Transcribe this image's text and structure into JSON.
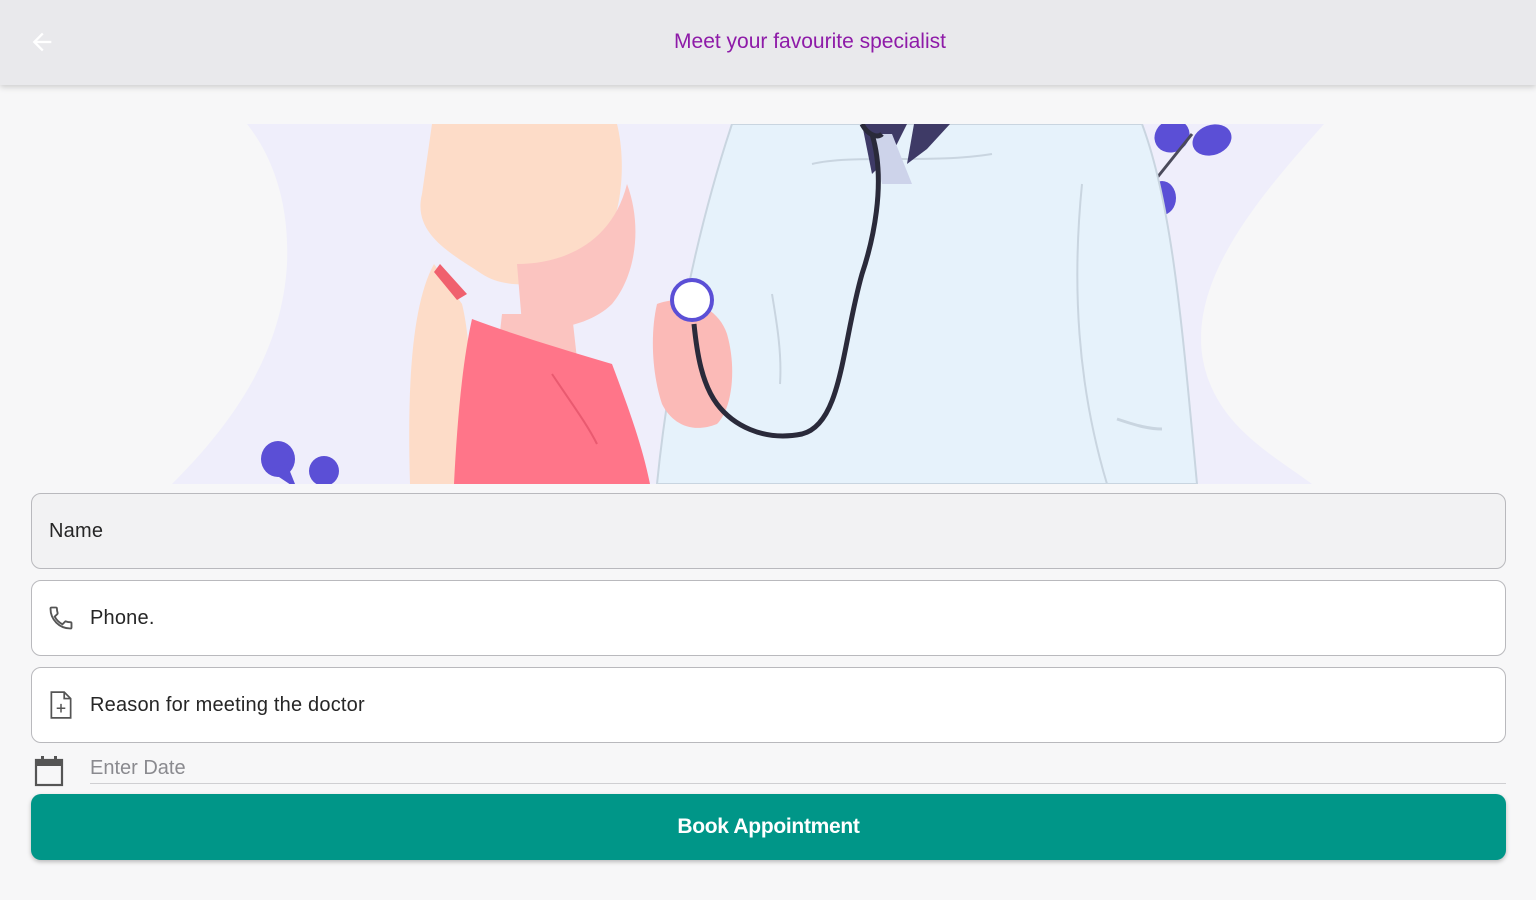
{
  "appbar": {
    "title": "Meet your favourite specialist",
    "back_icon": "arrow-left-icon",
    "title_color": "#8e1ba8"
  },
  "hero": {
    "illustration": "doctor-with-stethoscope-and-patient"
  },
  "form": {
    "name_label": "Name",
    "phone_label": "Phone.",
    "phone_icon": "phone-icon",
    "reason_label": "Reason for meeting the doctor",
    "reason_icon": "document-icon",
    "date_placeholder": "Enter Date",
    "date_icon": "calendar-icon",
    "submit_label": "Book Appointment"
  },
  "colors": {
    "accent": "#009688",
    "title": "#8e1ba8",
    "illustration_purple": "#5b4fd6"
  }
}
